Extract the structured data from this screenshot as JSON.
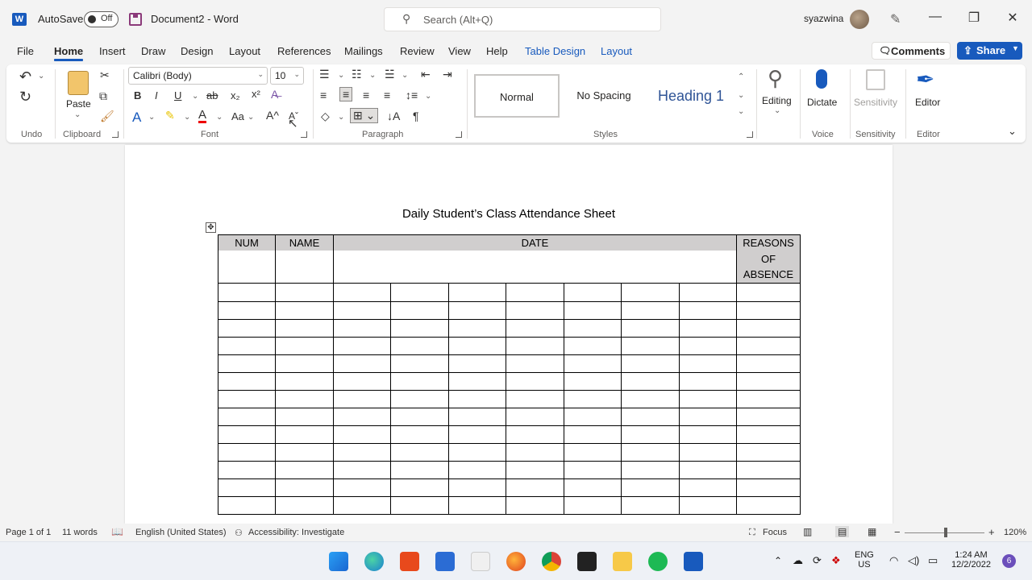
{
  "titlebar": {
    "autosave_label": "AutoSave",
    "autosave_state": "Off",
    "doc_title": "Document2  -  Word",
    "search_placeholder": "Search (Alt+Q)",
    "username": "syazwina",
    "word_logo": "W"
  },
  "tabs": [
    "File",
    "Home",
    "Insert",
    "Draw",
    "Design",
    "Layout",
    "References",
    "Mailings",
    "Review",
    "View",
    "Help",
    "Table Design",
    "Layout"
  ],
  "active_tab": "Home",
  "actions": {
    "comments": "Comments",
    "share": "Share"
  },
  "ribbon": {
    "groups": {
      "undo": "Undo",
      "clipboard": "Clipboard",
      "font": "Font",
      "paragraph": "Paragraph",
      "styles": "Styles",
      "voice": "Voice",
      "sensitivity": "Sensitivity",
      "editor": "Editor"
    },
    "paste_label": "Paste",
    "font_name": "Calibri (Body)",
    "font_size": "10",
    "styles": [
      "Normal",
      "No Spacing",
      "Heading 1"
    ],
    "editing_label": "Editing",
    "dictate_label": "Dictate",
    "sensitivity_label": "Sensitivity",
    "editor_label": "Editor"
  },
  "document": {
    "heading": "Daily Student’s Class Attendance Sheet",
    "table": {
      "headers": [
        "NUM",
        "NAME",
        "DATE"
      ],
      "reason_lines": [
        "REASONS",
        "OF",
        "ABSENCE"
      ],
      "date_columns": 7,
      "body_rows": 13
    }
  },
  "statusbar": {
    "page": "Page 1 of 1",
    "words": "11 words",
    "language": "English (United States)",
    "accessibility": "Accessibility: Investigate",
    "focus": "Focus",
    "zoom": "120%"
  },
  "taskbar": {
    "lang_top": "ENG",
    "lang_bottom": "US",
    "time": "1:24 AM",
    "date": "12/2/2022",
    "notifications": "6"
  },
  "colors": {
    "accent": "#185abd",
    "table_header_shade": "#d0cece"
  }
}
